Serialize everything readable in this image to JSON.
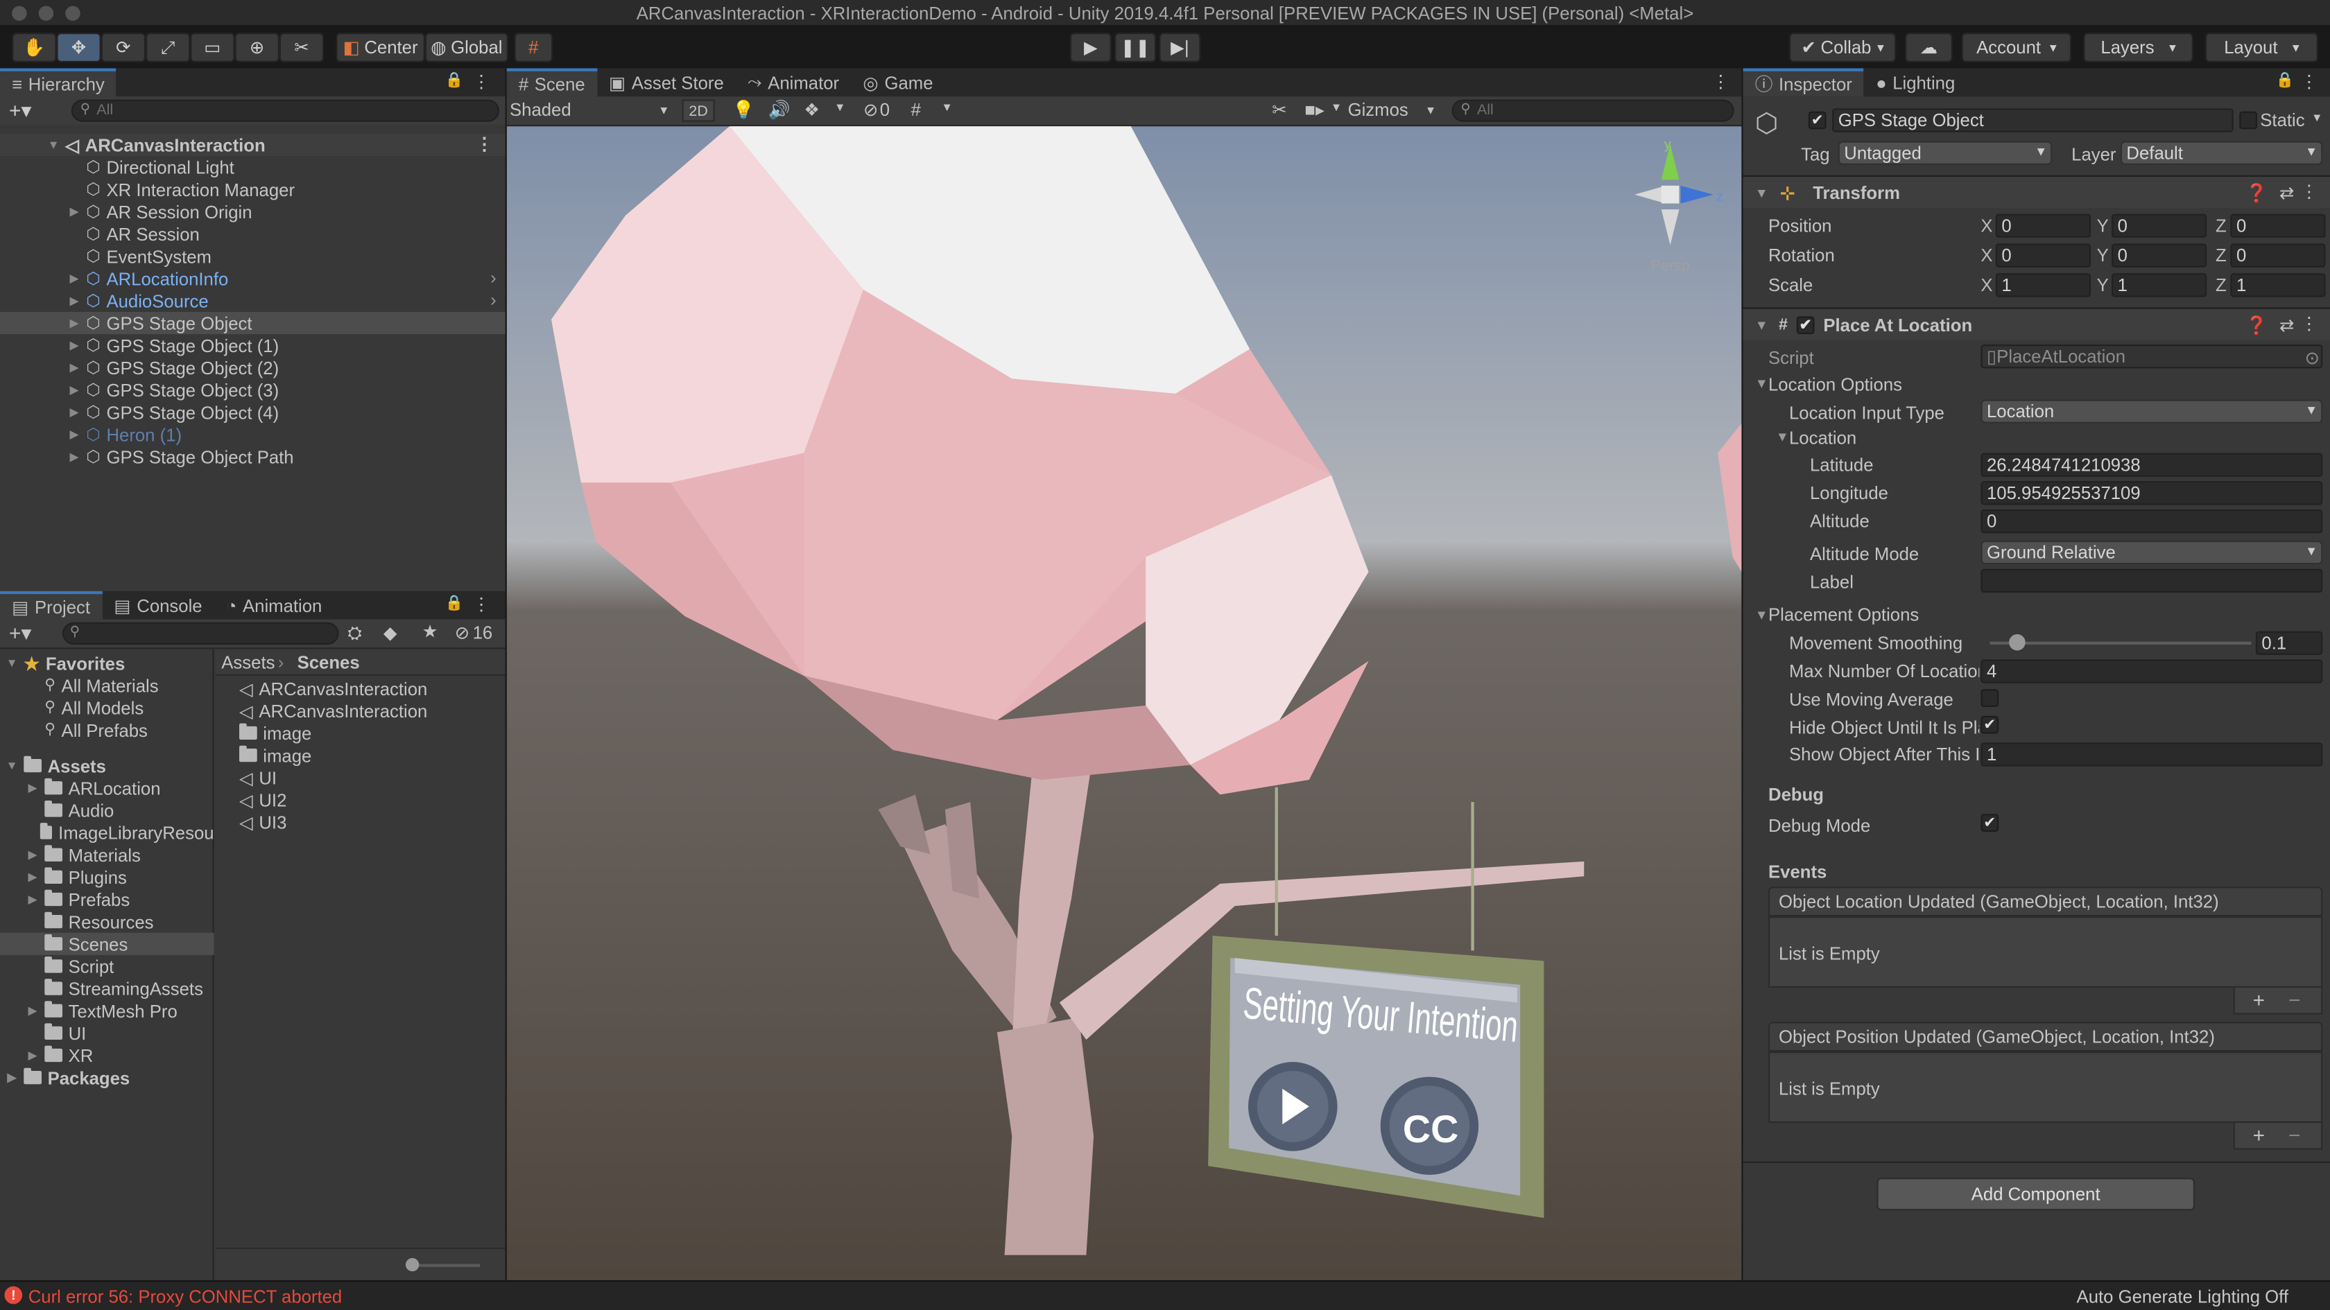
{
  "window": {
    "title": "ARCanvasInteraction - XRInteractionDemo - Android - Unity 2019.4.4f1 Personal [PREVIEW PACKAGES IN USE] (Personal) <Metal>"
  },
  "toolbar": {
    "pivot": "Center",
    "space": "Global",
    "collab": "Collab",
    "account": "Account",
    "layers": "Layers",
    "layout": "Layout"
  },
  "hierarchy": {
    "tab": "Hierarchy",
    "search_placeholder": "All",
    "scene": "ARCanvasInteraction",
    "items": [
      {
        "label": "Directional Light"
      },
      {
        "label": "XR Interaction Manager"
      },
      {
        "label": "AR Session Origin"
      },
      {
        "label": "AR Session"
      },
      {
        "label": "EventSystem"
      },
      {
        "label": "ARLocationInfo"
      },
      {
        "label": "AudioSource"
      },
      {
        "label": "GPS Stage Object"
      },
      {
        "label": "GPS Stage Object (1)"
      },
      {
        "label": "GPS Stage Object (2)"
      },
      {
        "label": "GPS Stage Object (3)"
      },
      {
        "label": "GPS Stage Object (4)"
      },
      {
        "label": "Heron (1)"
      },
      {
        "label": "GPS Stage Object Path"
      }
    ]
  },
  "project": {
    "tabs": [
      "Project",
      "Console",
      "Animation"
    ],
    "hidden_count": "16",
    "favorites": {
      "label": "Favorites",
      "items": [
        "All Materials",
        "All Models",
        "All Prefabs"
      ]
    },
    "assets": {
      "label": "Assets",
      "items": [
        "ARLocation",
        "Audio",
        "ImageLibraryResou",
        "Materials",
        "Plugins",
        "Prefabs",
        "Resources",
        "Scenes",
        "Script",
        "StreamingAssets",
        "TextMesh Pro",
        "UI",
        "XR"
      ]
    },
    "packages": "Packages",
    "breadcrumb": {
      "root": "Assets",
      "current": "Scenes"
    },
    "files": [
      "ARCanvasInteraction",
      "ARCanvasInteraction",
      "image",
      "image",
      "UI",
      "UI2",
      "UI3"
    ]
  },
  "scene_view": {
    "tabs": [
      "Scene",
      "Asset Store",
      "Animator",
      "Game"
    ],
    "shading": "Shaded",
    "mode_2d": "2D",
    "fx_count": "0",
    "gizmos": "Gizmos",
    "search_placeholder": "All",
    "persp": "Persp",
    "gizmo_axes": {
      "y": "y",
      "z": "z"
    },
    "sign_text": "Setting Your Intention",
    "cc_text": "CC"
  },
  "inspector": {
    "tabs": [
      "Inspector",
      "Lighting"
    ],
    "object_name": "GPS Stage Object",
    "static_label": "Static",
    "tag_label": "Tag",
    "tag_value": "Untagged",
    "layer_label": "Layer",
    "layer_value": "Default",
    "transform": {
      "title": "Transform",
      "rows": [
        {
          "label": "Position",
          "x": "0",
          "y": "0",
          "z": "0"
        },
        {
          "label": "Rotation",
          "x": "0",
          "y": "0",
          "z": "0"
        },
        {
          "label": "Scale",
          "x": "1",
          "y": "1",
          "z": "1"
        }
      ]
    },
    "place": {
      "title": "Place At Location",
      "script_label": "Script",
      "script_value": "PlaceAtLocation",
      "location_options": "Location Options",
      "input_type_label": "Location Input Type",
      "input_type_value": "Location",
      "location_label": "Location",
      "latitude_label": "Latitude",
      "latitude": "26.2484741210938",
      "longitude_label": "Longitude",
      "longitude": "105.954925537109",
      "altitude_label": "Altitude",
      "altitude": "0",
      "altitude_mode_label": "Altitude Mode",
      "altitude_mode": "Ground Relative",
      "label_label": "Label",
      "label_value": "",
      "placement_options": "Placement Options",
      "movement_smoothing_label": "Movement Smoothing",
      "movement_smoothing": "0.1",
      "movement_smoothing_fraction": 0.1,
      "max_locations_label": "Max Number Of Locatior",
      "max_locations": "4",
      "use_moving_average_label": "Use Moving Average",
      "hide_object_label": "Hide Object Until It Is Pla",
      "show_after_label": "Show Object After This I",
      "show_after": "1",
      "debug_header": "Debug",
      "debug_mode_label": "Debug Mode",
      "events_header": "Events",
      "event1_title": "Object Location Updated (GameObject, Location, Int32)",
      "event1_body": "List is Empty",
      "event2_title": "Object Position Updated (GameObject, Location, Int32)",
      "event2_body": "List is Empty"
    },
    "add_component": "Add Component"
  },
  "status": {
    "error": "Curl error 56: Proxy CONNECT aborted",
    "right": "Auto Generate Lighting Off"
  },
  "colors": {
    "accent": "#3a79bb",
    "error": "#e8493b",
    "prefab_blue": "#7cb1f2",
    "selection": "#4d4d4d"
  }
}
